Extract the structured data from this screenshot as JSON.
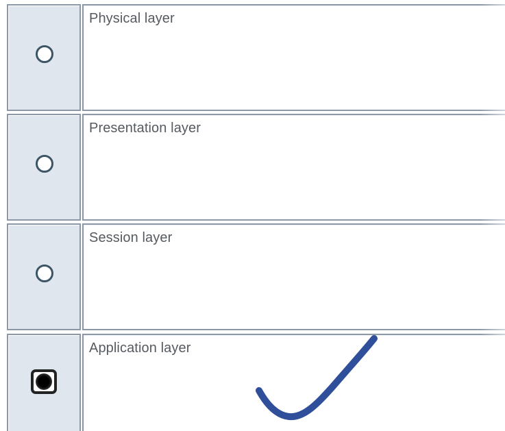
{
  "question": {
    "options": [
      {
        "label": "Physical layer",
        "selected": false
      },
      {
        "label": "Presentation layer",
        "selected": false
      },
      {
        "label": "Session layer",
        "selected": false
      },
      {
        "label": "Application layer",
        "selected": true
      }
    ]
  },
  "annotation": {
    "mark": "checkmark-icon",
    "color": "#2f4f9a"
  },
  "colors": {
    "radio_cell_bg": "#dfe6ee",
    "border": "#8c98a6",
    "label_text": "#555a60"
  }
}
